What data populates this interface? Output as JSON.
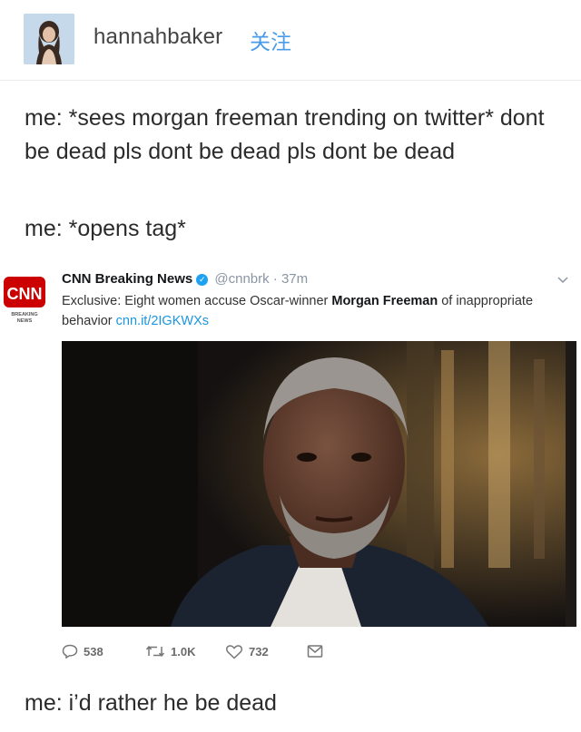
{
  "post": {
    "username": "hannahbaker",
    "follow_label": "关注",
    "lines": {
      "para1": "me: *sees morgan freeman trending on twitter* dont be dead pls dont be dead pls dont be dead",
      "para2": "me: *opens tag*",
      "para3": "me: i’d rather he be dead"
    }
  },
  "tweet": {
    "author": "CNN Breaking News",
    "handle": "@cnnbrk · 37m",
    "logo_text": "CNN",
    "logo_sub": "BREAKING NEWS",
    "text_before": "Exclusive: Eight women accuse Oscar-winner ",
    "text_bold": "Morgan Freeman",
    "text_after": " of inappropriate behavior ",
    "link": "cnn.it/2IGKWXs",
    "actions": {
      "replies": "538",
      "retweets": "1.0K",
      "likes": "732"
    }
  },
  "colors": {
    "follow": "#4a9be8",
    "link": "#1b95e0",
    "cnn_red": "#cc0000",
    "verified": "#1da1f2"
  },
  "icons": [
    "chevron-down-icon",
    "reply-icon",
    "retweet-icon",
    "like-icon",
    "dm-icon",
    "verified-icon"
  ]
}
